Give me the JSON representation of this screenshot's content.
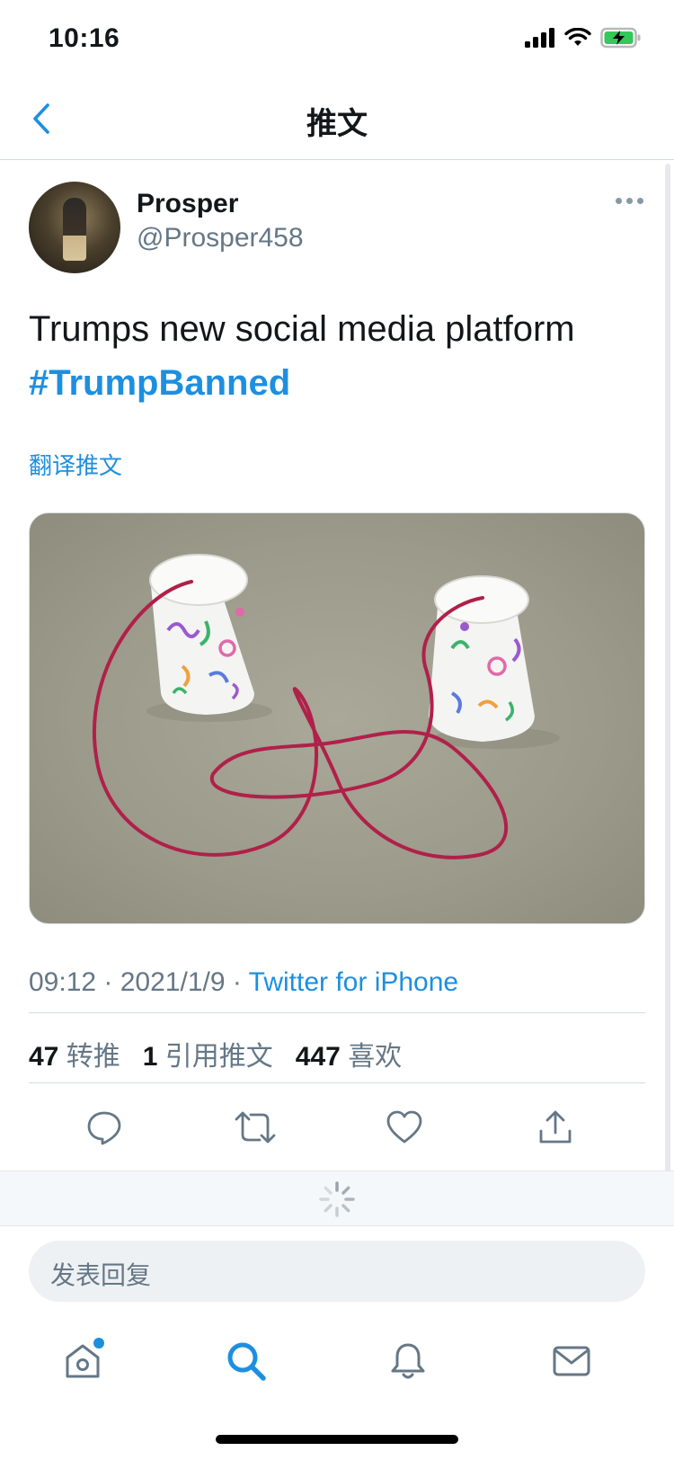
{
  "status_bar": {
    "time": "10:16"
  },
  "nav": {
    "title": "推文"
  },
  "tweet": {
    "display_name": "Prosper",
    "handle": "@Prosper458",
    "text": "Trumps new social media platform",
    "hashtag": "#TrumpBanned",
    "translate_label": "翻译推文",
    "meta": {
      "time": "09:12",
      "date": "2021/1/9",
      "source": "Twitter for iPhone"
    },
    "stats": {
      "retweets_count": "47",
      "retweets_label": "转推",
      "quotes_count": "1",
      "quotes_label": "引用推文",
      "likes_count": "447",
      "likes_label": "喜欢"
    }
  },
  "reply": {
    "placeholder": "发表回复"
  },
  "tab_bar": {
    "items": [
      {
        "icon": "home-icon",
        "active": false,
        "badge": true
      },
      {
        "icon": "search-icon",
        "active": true,
        "badge": false
      },
      {
        "icon": "bell-icon",
        "active": false,
        "badge": false
      },
      {
        "icon": "mail-icon",
        "active": false,
        "badge": false
      }
    ]
  },
  "colors": {
    "accent": "#1d8fe0",
    "text": "#14171a",
    "secondary": "#657786",
    "divider": "#d6dbe0"
  }
}
